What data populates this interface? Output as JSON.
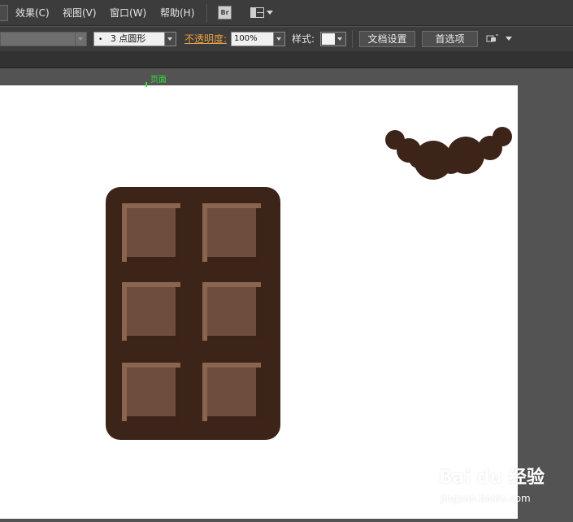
{
  "menubar": {
    "items": [
      "效果(C)",
      "视图(V)",
      "窗口(W)",
      "帮助(H)"
    ],
    "bridge_button": "Br"
  },
  "controlbar": {
    "stroke_profile": "3 点圆形",
    "opacity_label": "不透明度:",
    "opacity_value": "100%",
    "style_label": "样式:",
    "doc_setup_button": "文档设置",
    "preferences_button": "首选项"
  },
  "artboard": {
    "page_label": "页面"
  },
  "artwork": {
    "chocolate_bar_color": "#3c2418",
    "chocolate_square_color": "#6e4d3c",
    "chocolate_highlight_color": "#8a6550",
    "cloud_color": "#3c2418"
  },
  "watermark": {
    "logo": "Bai du 经验",
    "url": "jingyan.baidu.com"
  },
  "colors": {
    "ui_dark": "#3c3c3c",
    "pasteboard": "#535353",
    "opacity_label": "#e8a040",
    "page_label": "#35e035"
  }
}
